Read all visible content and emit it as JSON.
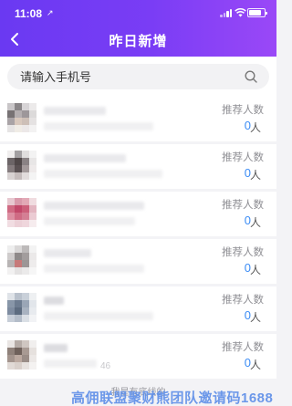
{
  "status_bar": {
    "time": "11:08",
    "location_arrow": "↗"
  },
  "nav": {
    "title": "昨日新增",
    "back_icon": "chevron-left-icon"
  },
  "search": {
    "placeholder": "请输入手机号",
    "icon": "search-icon"
  },
  "rows": [
    {
      "rec_label": "推荐人数",
      "rec_value": "0",
      "rec_unit": "人",
      "tail": ""
    },
    {
      "rec_label": "推荐人数",
      "rec_value": "0",
      "rec_unit": "人",
      "tail": ""
    },
    {
      "rec_label": "推荐人数",
      "rec_value": "0",
      "rec_unit": "人",
      "tail": ""
    },
    {
      "rec_label": "推荐人数",
      "rec_value": "0",
      "rec_unit": "人",
      "tail": ""
    },
    {
      "rec_label": "推荐人数",
      "rec_value": "0",
      "rec_unit": "人",
      "tail": ""
    },
    {
      "rec_label": "推荐人数",
      "rec_value": "0",
      "rec_unit": "人",
      "tail": "46"
    }
  ],
  "footer": {
    "text": "我是有底线的"
  },
  "watermark": {
    "text": "高佣联盟聚财熊团队邀请码1688"
  },
  "colors": {
    "header_start": "#6a39f2",
    "header_end": "#9a48f7",
    "value_blue": "#3b8cf5"
  }
}
